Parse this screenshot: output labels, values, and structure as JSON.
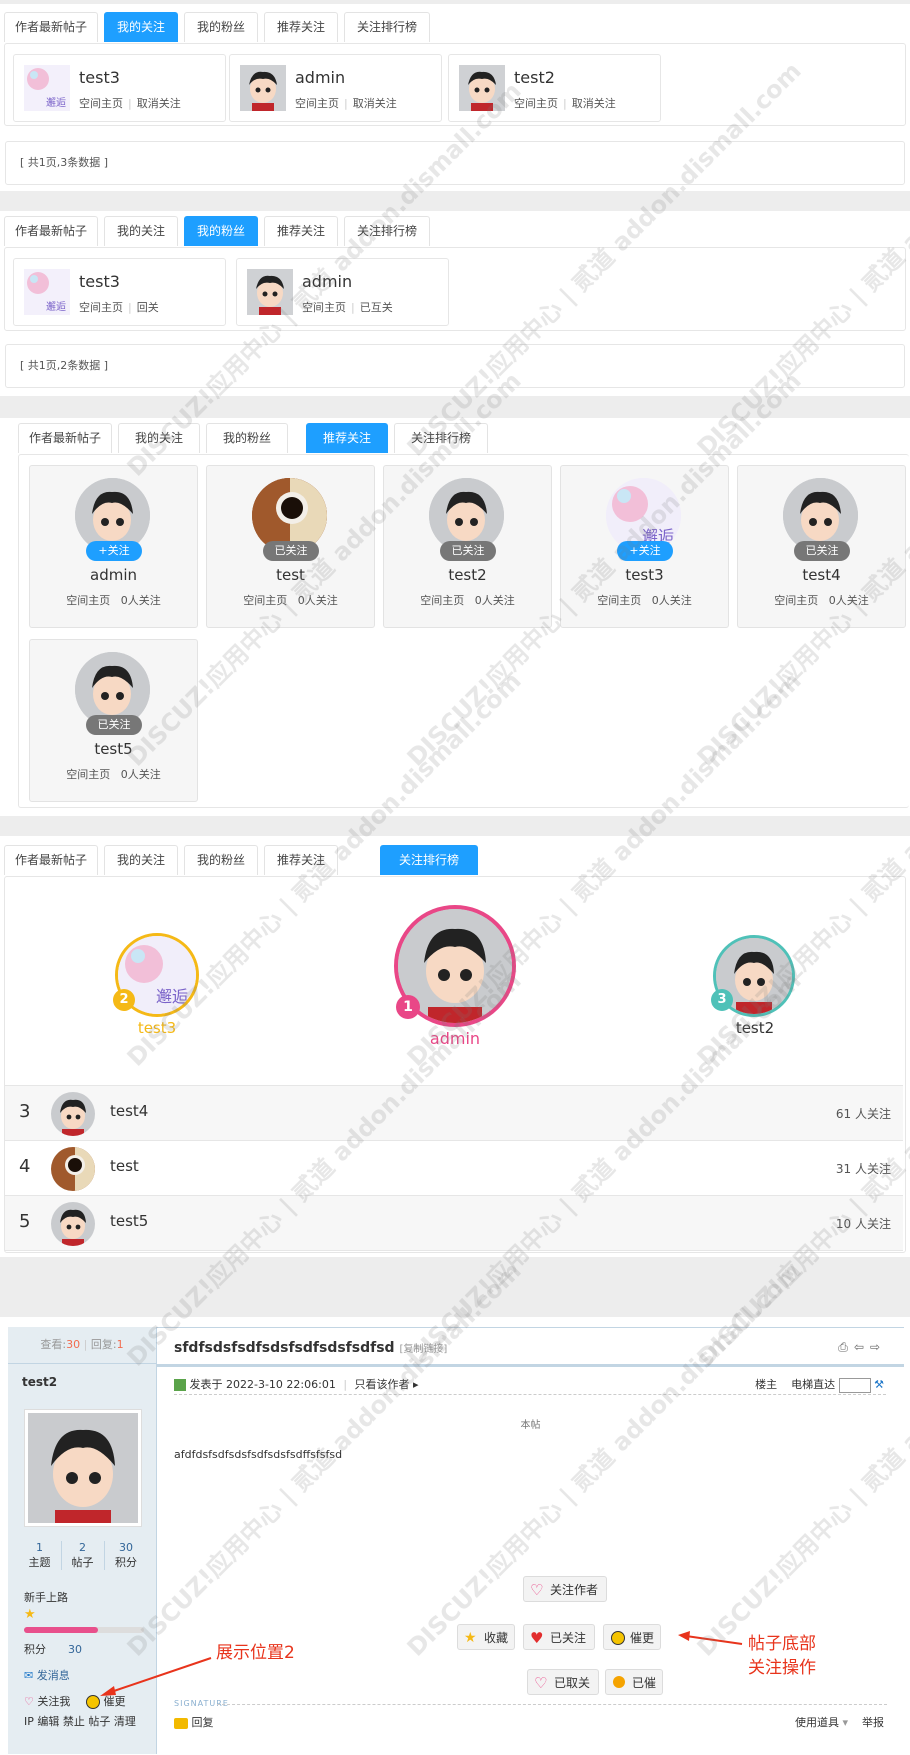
{
  "tabs": [
    "作者最新帖子",
    "我的关注",
    "我的粉丝",
    "推荐关注",
    "关注排行榜"
  ],
  "following": {
    "cards": [
      {
        "name": "test3",
        "links": [
          "空间主页",
          "取消关注"
        ]
      },
      {
        "name": "admin",
        "links": [
          "空间主页",
          "取消关注"
        ]
      },
      {
        "name": "test2",
        "links": [
          "空间主页",
          "取消关注"
        ]
      }
    ],
    "pager": "[ 共1页,3条数据 ]"
  },
  "fans": {
    "cards": [
      {
        "name": "test3",
        "links": [
          "空间主页",
          "回关"
        ]
      },
      {
        "name": "admin",
        "links": [
          "空间主页",
          "已互关"
        ]
      }
    ],
    "pager": "[ 共1页,2条数据 ]"
  },
  "recommend": {
    "cards": [
      {
        "name": "admin",
        "btn": "+关注",
        "state": "follow",
        "links": [
          "空间主页",
          "0人关注"
        ]
      },
      {
        "name": "test",
        "btn": "已关注",
        "state": "followed",
        "links": [
          "空间主页",
          "0人关注"
        ]
      },
      {
        "name": "test2",
        "btn": "已关注",
        "state": "followed",
        "links": [
          "空间主页",
          "0人关注"
        ]
      },
      {
        "name": "test3",
        "btn": "+关注",
        "state": "follow",
        "links": [
          "空间主页",
          "0人关注"
        ]
      },
      {
        "name": "test4",
        "btn": "已关注",
        "state": "followed",
        "links": [
          "空间主页",
          "0人关注"
        ]
      },
      {
        "name": "test5",
        "btn": "已关注",
        "state": "followed",
        "links": [
          "空间主页",
          "0人关注"
        ]
      }
    ]
  },
  "ranking": {
    "podium": [
      {
        "rank": "2",
        "name": "test3",
        "color": "#f5b916"
      },
      {
        "rank": "1",
        "name": "admin",
        "color": "#e94787"
      },
      {
        "rank": "3",
        "name": "test2",
        "color": "#4fc1b8"
      }
    ],
    "rows": [
      {
        "rank": "3",
        "name": "test4",
        "count": "61 人关注"
      },
      {
        "rank": "4",
        "name": "test",
        "count": "31 人关注"
      },
      {
        "rank": "5",
        "name": "test5",
        "count": "10 人关注"
      }
    ]
  },
  "forum": {
    "views_label": "查看:",
    "views": "30",
    "replies_label": "回复:",
    "replies": "1",
    "title": "sfdfsdsfsdfsdsfsdfsdsfsdfsd",
    "copy_link": "[复制链接]",
    "post_time": "发表于 2022-3-10 22:06:01",
    "only_author": "只看该作者",
    "floor_label": "楼主",
    "elevator_label": "电梯直达",
    "content_label": "本帖",
    "content": "afdfdsfsdfsdsfsdfsdsfsdffsfsfsd",
    "author": "test2",
    "stats": [
      {
        "value": "1",
        "label": "主题"
      },
      {
        "value": "2",
        "label": "帖子"
      },
      {
        "value": "30",
        "label": "积分"
      }
    ],
    "level": "新手上路",
    "points_label": "积分",
    "points": "30",
    "message": "发消息",
    "follow_me": "关注我",
    "urge": "催更",
    "admin_links": "IP 编辑 禁止 帖子 清理",
    "follow_author_btn": "关注作者",
    "fav_btn": "收藏",
    "followed_btn": "已关注",
    "urge_btn": "催更",
    "unfollowed_btn": "已取关",
    "urged_btn": "已催",
    "signature": "SIGNATURE",
    "reply": "回复",
    "tools": "使用道具",
    "report": "举报",
    "annot_left": "展示位置2",
    "annot_right_1": "帖子底部",
    "annot_right_2": "关注操作"
  },
  "watermark": "DISCUZ!应用中心 | 贰道 addon.dismall.com",
  "colors": {
    "accent": "#1e9fff",
    "gray_pill": "#777777",
    "annotation": "#e8341c"
  }
}
